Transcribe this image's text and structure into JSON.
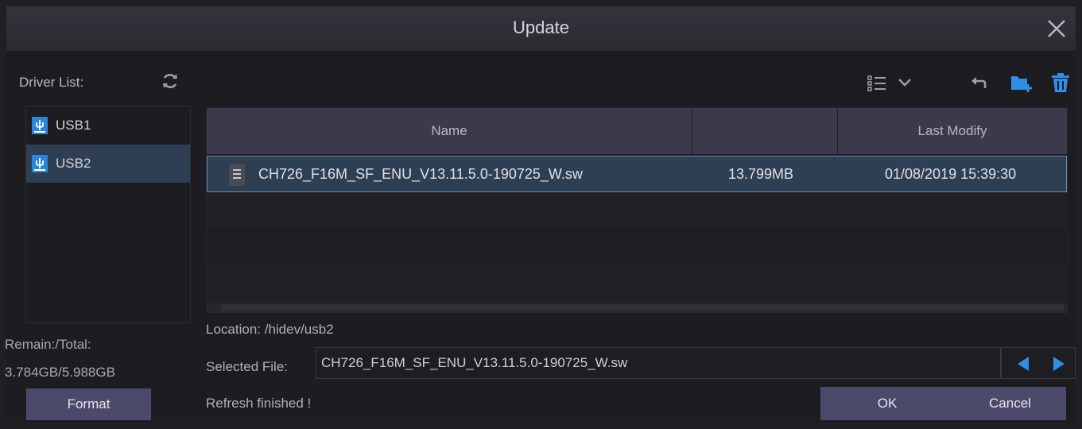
{
  "dialog": {
    "title": "Update"
  },
  "drivers": {
    "label": "Driver List:",
    "items": [
      {
        "label": "USB1",
        "icon": "usb-icon"
      },
      {
        "label": "USB2",
        "icon": "usb-icon"
      }
    ],
    "remain_label": "Remain:/Total:",
    "remain_value": "3.784GB/5.988GB",
    "format_label": "Format"
  },
  "toolbar": {
    "view": "list-view-icon",
    "dropdown": "chevron-down-icon",
    "back": "back-arrow-icon",
    "new_folder": "new-folder-icon",
    "delete": "trash-icon"
  },
  "table": {
    "columns": [
      "Name",
      "",
      "Last Modify"
    ],
    "rows": [
      {
        "name": "CH726_F16M_SF_ENU_V13.11.5.0-190725_W.sw",
        "size": "13.799MB",
        "modified": "01/08/2019 15:39:30"
      }
    ]
  },
  "location": "Location: /hidev/usb2",
  "selected_file": {
    "label": "Selected File:",
    "value": "CH726_F16M_SF_ENU_V13.11.5.0-190725_W.sw"
  },
  "status": "Refresh finished !",
  "buttons": {
    "ok": "OK",
    "cancel": "Cancel"
  },
  "colors": {
    "accent": "#2f8fe8",
    "selection": "#2e3f54",
    "button": "#4b4a6b"
  }
}
